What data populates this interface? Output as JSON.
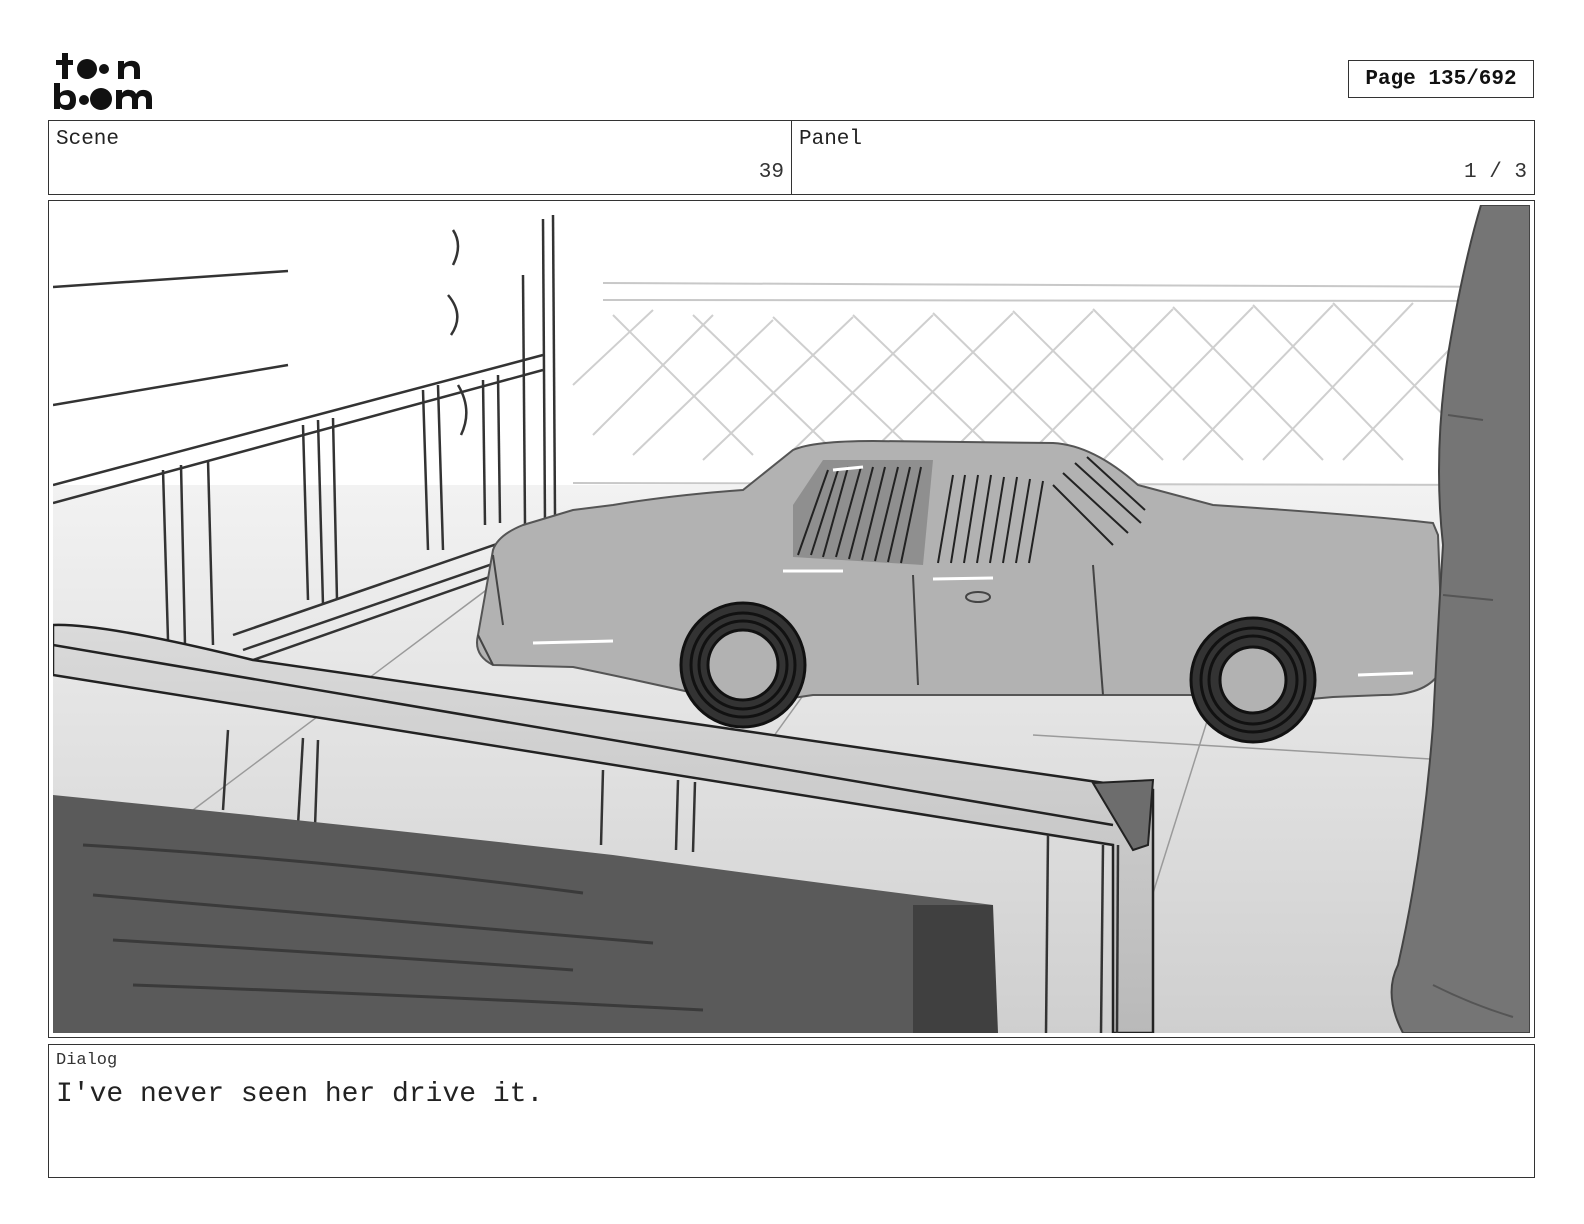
{
  "logo": {
    "line1": "toon",
    "line2": "boom",
    "icon": "toon-boom-logo"
  },
  "header": {
    "page_indicator": "Page 135/692"
  },
  "info": {
    "scene_label": "Scene",
    "scene_value": "39",
    "panel_label": "Panel",
    "panel_value": "1 / 3"
  },
  "panel": {
    "image": "storyboard-sketch-car-parked-by-fence"
  },
  "dialog": {
    "label": "Dialog",
    "text": "I've never seen her drive it."
  }
}
